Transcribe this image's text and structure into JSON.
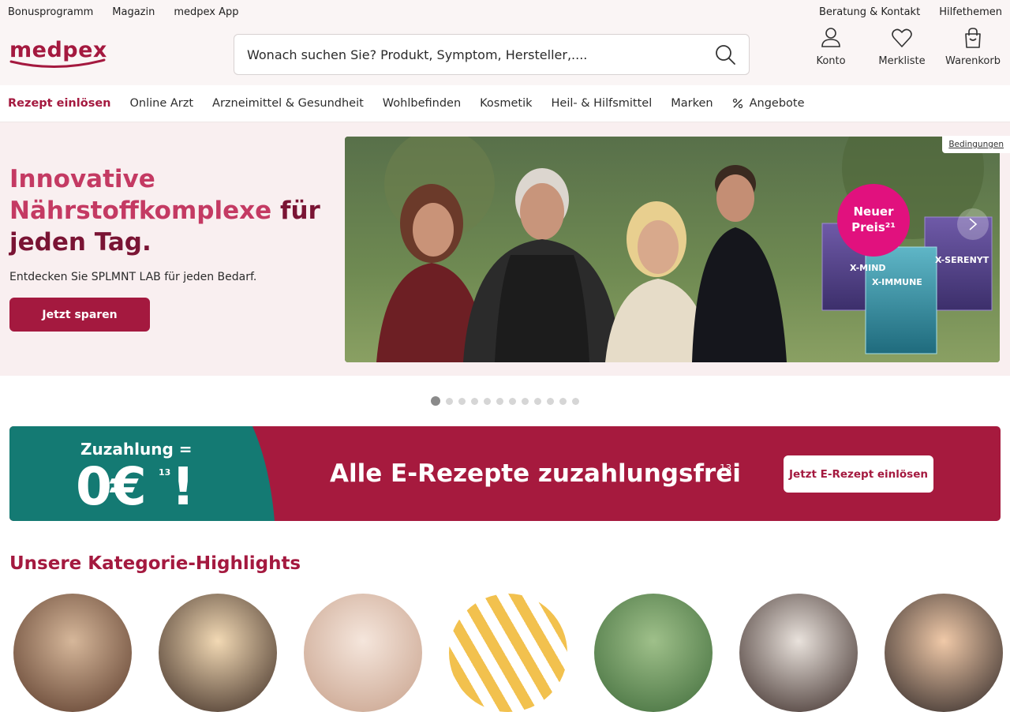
{
  "utility": {
    "left": [
      "Bonusprogramm",
      "Magazin",
      "medpex App"
    ],
    "right": [
      "Beratung & Kontakt",
      "Hilfethemen"
    ]
  },
  "brand": {
    "name": "medpex",
    "color": "#a4193f"
  },
  "search": {
    "placeholder": "Wonach suchen Sie? Produkt, Symptom, Hersteller,...."
  },
  "actions": {
    "account": "Konto",
    "wishlist": "Merkliste",
    "cart": "Warenkorb"
  },
  "nav": {
    "rezept": "Rezept einlösen",
    "items": [
      "Online Arzt",
      "Arzneimittel & Gesundheit",
      "Wohlbefinden",
      "Kosmetik",
      "Heil- & Hilfsmittel",
      "Marken"
    ],
    "offers": "Angebote"
  },
  "hero": {
    "title_accent_1": "Innovative",
    "title_accent_2": "Nährstoffkomplexe",
    "title_dark_1": "für",
    "title_dark_2": "jeden Tag.",
    "subtitle": "Entdecken Sie SPLMNT LAB für jeden Bedarf.",
    "button": "Jetzt sparen",
    "conditions": "Bedingungen",
    "badge_line1": "Neuer",
    "badge_line2": "Preis²¹",
    "products": [
      "X-MIND",
      "X-IMMUNE",
      "X-SERENYT"
    ],
    "slide_count": 12,
    "active_slide": 1
  },
  "banner": {
    "label": "Zuzahlung =",
    "amount": "0€",
    "amount_sup": "13",
    "exclaim": "!",
    "headline": "Alle E-Rezepte zuzahlungsfrei",
    "headline_sup": "13",
    "cta": "Jetzt E-Rezept einlösen"
  },
  "highlights": {
    "title": "Unsere Kategorie-Highlights"
  }
}
